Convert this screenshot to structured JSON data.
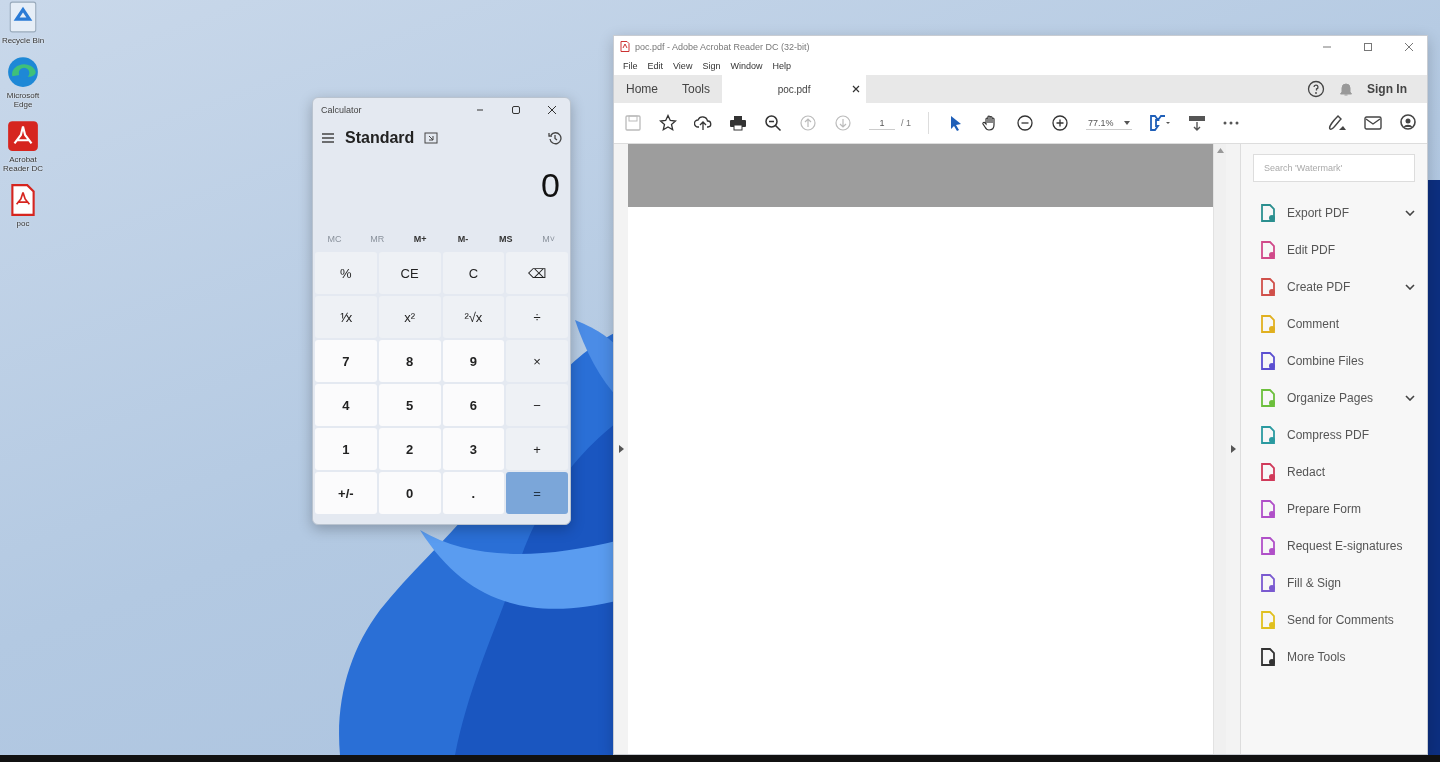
{
  "desktop": {
    "icons": [
      {
        "label": "Recycle Bin",
        "kind": "recycle"
      },
      {
        "label": "Microsoft Edge",
        "kind": "browser"
      },
      {
        "label": "Acrobat Reader DC",
        "kind": "reader"
      },
      {
        "label": "poc",
        "kind": "pdf"
      }
    ]
  },
  "calculator": {
    "title": "Calculator",
    "mode": "Standard",
    "display": "0",
    "memory": [
      {
        "label": "MC",
        "disabled": true
      },
      {
        "label": "MR",
        "disabled": true
      },
      {
        "label": "M+",
        "disabled": false
      },
      {
        "label": "M-",
        "disabled": false
      },
      {
        "label": "MS",
        "disabled": false
      },
      {
        "label": "M˅",
        "disabled": true
      }
    ],
    "keys": [
      {
        "label": "%",
        "kind": "fn"
      },
      {
        "label": "CE",
        "kind": "fn"
      },
      {
        "label": "C",
        "kind": "fn"
      },
      {
        "label": "⌫",
        "kind": "fn"
      },
      {
        "label": "⅟x",
        "kind": "fn"
      },
      {
        "label": "x²",
        "kind": "fn"
      },
      {
        "label": "²√x",
        "kind": "fn"
      },
      {
        "label": "÷",
        "kind": "fn"
      },
      {
        "label": "7",
        "kind": "digit"
      },
      {
        "label": "8",
        "kind": "digit"
      },
      {
        "label": "9",
        "kind": "digit"
      },
      {
        "label": "×",
        "kind": "fn"
      },
      {
        "label": "4",
        "kind": "digit"
      },
      {
        "label": "5",
        "kind": "digit"
      },
      {
        "label": "6",
        "kind": "digit"
      },
      {
        "label": "−",
        "kind": "fn"
      },
      {
        "label": "1",
        "kind": "digit"
      },
      {
        "label": "2",
        "kind": "digit"
      },
      {
        "label": "3",
        "kind": "digit"
      },
      {
        "label": "+",
        "kind": "fn"
      },
      {
        "label": "+/-",
        "kind": "digit"
      },
      {
        "label": "0",
        "kind": "digit"
      },
      {
        "label": ".",
        "kind": "digit"
      },
      {
        "label": "=",
        "kind": "equals"
      }
    ]
  },
  "acrobat": {
    "title": "poc.pdf - Adobe Acrobat Reader DC (32-bit)",
    "menu": [
      "File",
      "Edit",
      "View",
      "Sign",
      "Window",
      "Help"
    ],
    "tabs": [
      {
        "label": "Home",
        "selected": false
      },
      {
        "label": "Tools",
        "selected": false
      },
      {
        "label": "poc.pdf",
        "selected": true
      }
    ],
    "sign_in": "Sign In",
    "page_current": "1",
    "page_total": "/ 1",
    "zoom": "77.1%",
    "search": {
      "placeholder": "Search 'Watermark'"
    },
    "tools": [
      {
        "label": "Export PDF",
        "color": "#2b8f8f",
        "expandable": true
      },
      {
        "label": "Edit PDF",
        "color": "#d04a8a",
        "expandable": false
      },
      {
        "label": "Create PDF",
        "color": "#d0504a",
        "expandable": true
      },
      {
        "label": "Comment",
        "color": "#e0b020",
        "expandable": false
      },
      {
        "label": "Combine Files",
        "color": "#5b4fd0",
        "expandable": false
      },
      {
        "label": "Organize Pages",
        "color": "#6cbf3c",
        "expandable": true
      },
      {
        "label": "Compress PDF",
        "color": "#2a9aa0",
        "expandable": false
      },
      {
        "label": "Redact",
        "color": "#d03a5a",
        "expandable": false
      },
      {
        "label": "Prepare Form",
        "color": "#b050c8",
        "expandable": false
      },
      {
        "label": "Request E-signatures",
        "color": "#b050c8",
        "expandable": false
      },
      {
        "label": "Fill & Sign",
        "color": "#7a5ad0",
        "expandable": false
      },
      {
        "label": "Send for Comments",
        "color": "#e0c020",
        "expandable": false
      },
      {
        "label": "More Tools",
        "color": "#333333",
        "expandable": false
      }
    ]
  }
}
